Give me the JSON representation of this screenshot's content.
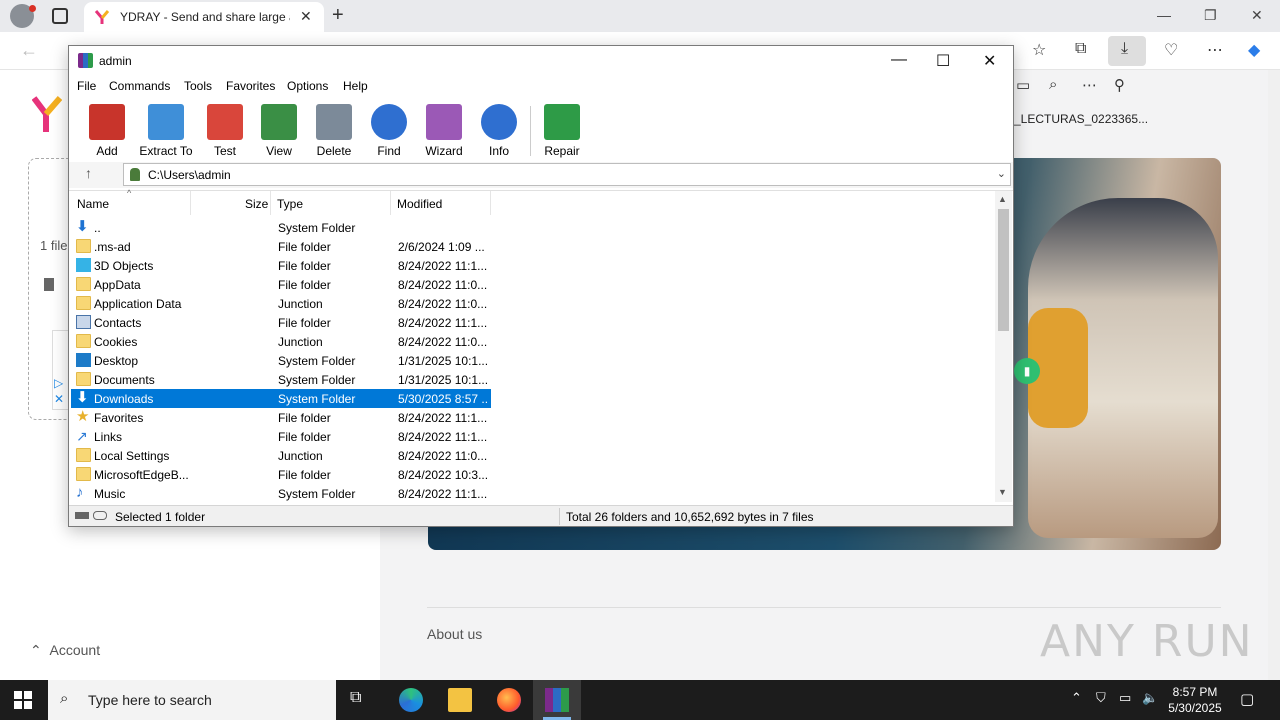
{
  "browser": {
    "tab_title": "YDRAY - Send and share large and",
    "new_tab": "+",
    "tab_close": "✕",
    "win_min": "—",
    "win_restore": "❐",
    "win_close": "✕"
  },
  "page": {
    "files_text": "1 file",
    "right_filename": "_LECTURAS_0223365...",
    "account": "Account",
    "about": "About us",
    "watermark": "ANY RUN"
  },
  "rar": {
    "title": "admin",
    "menu": [
      "File",
      "Commands",
      "Tools",
      "Favorites",
      "Options",
      "Help"
    ],
    "tools": [
      {
        "label": "Add",
        "color": "#c8342b"
      },
      {
        "label": "Extract To",
        "color": "#3f8fd8"
      },
      {
        "label": "Test",
        "color": "#d9463b"
      },
      {
        "label": "View",
        "color": "#3a8f45"
      },
      {
        "label": "Delete",
        "color": "#7c8a99"
      },
      {
        "label": "Find",
        "color": "#2f6fd0"
      },
      {
        "label": "Wizard",
        "color": "#9b59b6"
      },
      {
        "label": "Info",
        "color": "#2f6fd0"
      },
      {
        "label": "Repair",
        "color": "#2e9b47"
      }
    ],
    "path": "C:\\Users\\admin",
    "columns": {
      "name": "Name",
      "size": "Size",
      "type": "Type",
      "modified": "Modified"
    },
    "rows": [
      {
        "name": "..",
        "type": "System Folder",
        "modified": "",
        "icon": "arrow"
      },
      {
        "name": ".ms-ad",
        "type": "File folder",
        "modified": "2/6/2024 1:09 ...",
        "icon": "folder"
      },
      {
        "name": "3D Objects",
        "type": "File folder",
        "modified": "8/24/2022 11:1...",
        "icon": "blue3d"
      },
      {
        "name": "AppData",
        "type": "File folder",
        "modified": "8/24/2022 11:0...",
        "icon": "folder"
      },
      {
        "name": "Application Data",
        "type": "Junction",
        "modified": "8/24/2022 11:0...",
        "icon": "folder"
      },
      {
        "name": "Contacts",
        "type": "File folder",
        "modified": "8/24/2022 11:1...",
        "icon": "contacts"
      },
      {
        "name": "Cookies",
        "type": "Junction",
        "modified": "8/24/2022 11:0...",
        "icon": "folder"
      },
      {
        "name": "Desktop",
        "type": "System Folder",
        "modified": "1/31/2025 10:1...",
        "icon": "desktop"
      },
      {
        "name": "Documents",
        "type": "System Folder",
        "modified": "1/31/2025 10:1...",
        "icon": "folder"
      },
      {
        "name": "Downloads",
        "type": "System Folder",
        "modified": "5/30/2025 8:57 ...",
        "icon": "arrow",
        "selected": true
      },
      {
        "name": "Favorites",
        "type": "File folder",
        "modified": "8/24/2022 11:1...",
        "icon": "star"
      },
      {
        "name": "Links",
        "type": "File folder",
        "modified": "8/24/2022 11:1...",
        "icon": "links"
      },
      {
        "name": "Local Settings",
        "type": "Junction",
        "modified": "8/24/2022 11:0...",
        "icon": "folder"
      },
      {
        "name": "MicrosoftEdgeB...",
        "type": "File folder",
        "modified": "8/24/2022 10:3...",
        "icon": "folder"
      },
      {
        "name": "Music",
        "type": "System Folder",
        "modified": "8/24/2022 11:1...",
        "icon": "music"
      }
    ],
    "status_left": "Selected 1 folder",
    "status_right": "Total 26 folders and 10,652,692 bytes in 7 files"
  },
  "taskbar": {
    "search_placeholder": "Type here to search",
    "time": "8:57 PM",
    "date": "5/30/2025"
  }
}
